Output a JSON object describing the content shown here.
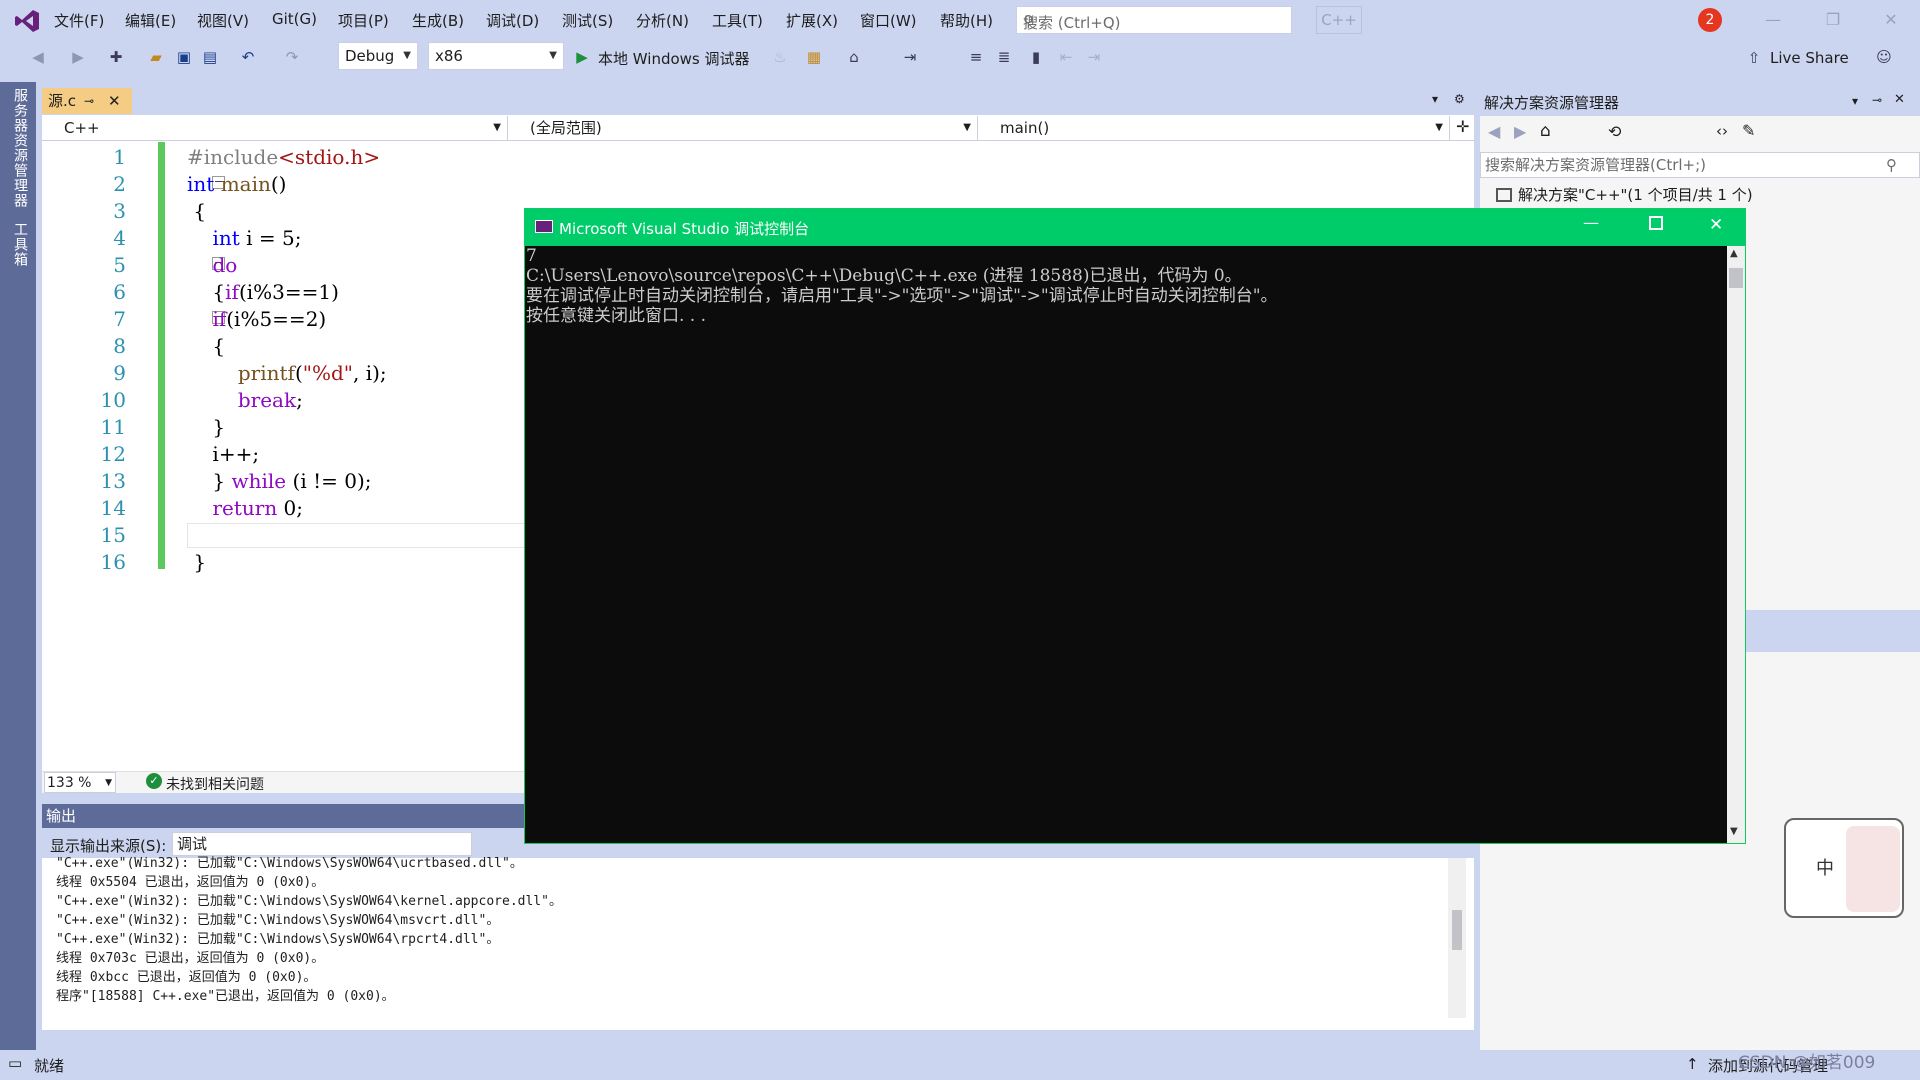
{
  "menu": [
    "文件(F)",
    "编辑(E)",
    "视图(V)",
    "Git(G)",
    "项目(P)",
    "生成(B)",
    "调试(D)",
    "测试(S)",
    "分析(N)",
    "工具(T)",
    "扩展(X)",
    "窗口(W)",
    "帮助(H)"
  ],
  "search": {
    "placeholder": "搜索 (Ctrl+Q)"
  },
  "solution_badge": "C++",
  "notification_count": "2",
  "toolbar": {
    "config": "Debug",
    "platform": "x86",
    "run_label": "本地 Windows 调试器",
    "live_share": "Live Share"
  },
  "side_tabs": [
    "服务器资源管理器",
    "工具箱"
  ],
  "editor": {
    "tab_label": "源.c",
    "nav_project": "C++",
    "nav_scope": "(全局范围)",
    "nav_member": "main()",
    "line_numbers": [
      "1",
      "2",
      "3",
      "4",
      "5",
      "6",
      "7",
      "8",
      "9",
      "10",
      "11",
      "12",
      "13",
      "14",
      "15",
      "16"
    ],
    "zoom": "133 %",
    "issues": "未找到相关问题"
  },
  "output": {
    "title": "输出",
    "source_label": "显示输出来源(S):",
    "source_value": "调试",
    "lines": [
      "\"C++.exe\"(Win32): 已加载\"C:\\Windows\\SysWOW64\\ucrtbased.dll\"。",
      "线程 0x5504 已退出，返回值为 0 (0x0)。",
      "\"C++.exe\"(Win32): 已加载\"C:\\Windows\\SysWOW64\\kernel.appcore.dll\"。",
      "\"C++.exe\"(Win32): 已加载\"C:\\Windows\\SysWOW64\\msvcrt.dll\"。",
      "\"C++.exe\"(Win32): 已加载\"C:\\Windows\\SysWOW64\\rpcrt4.dll\"。",
      "线程 0x703c 已退出，返回值为 0 (0x0)。",
      "线程 0xbcc 已退出，返回值为 0 (0x0)。",
      "程序\"[18588] C++.exe\"已退出，返回值为 0 (0x0)。"
    ]
  },
  "status": {
    "ready": "就绪",
    "add_source": "添加到源代码管理",
    "watermark": "CSDN @如茗009"
  },
  "solution_explorer": {
    "title": "解决方案资源管理器",
    "search_placeholder": "搜索解决方案资源管理器(Ctrl+;)",
    "root": "解决方案\"C++\"(1 个项目/共 1 个)"
  },
  "console": {
    "title": "Microsoft Visual Studio 调试控制台",
    "lines": [
      "7",
      "C:\\Users\\Lenovo\\source\\repos\\C++\\Debug\\C++.exe (进程 18588)已退出，代码为 0。",
      "要在调试停止时自动关闭控制台，请启用\"工具\"->\"选项\"->\"调试\"->\"调试停止时自动关闭控制台\"。",
      "按任意键关闭此窗口. . ."
    ]
  },
  "ime": {
    "label": "中"
  }
}
